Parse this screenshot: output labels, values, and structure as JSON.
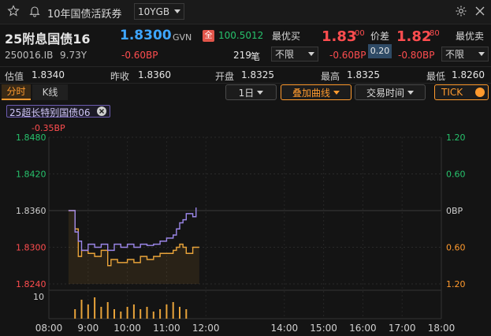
{
  "header": {
    "title": "10年国债活跃券",
    "dropdown_value": "10YGB"
  },
  "quote": {
    "name": "25附息国债16",
    "price": "1.8300",
    "price_unit": "GVN",
    "valuation_badge": "全",
    "valuation_price": "100.5012",
    "code": "250016.IB",
    "tenor": "9.73Y",
    "change": "-0.60BP",
    "volume": "219",
    "volume_unit": "笔",
    "best_buy_label": "最优买",
    "best_buy_main": "1.83",
    "best_buy_sub": "00",
    "best_buy_change": "-0.60BP",
    "best_buy_filter": "不限",
    "spread_label": "价差",
    "spread_value": "0.20",
    "best_sell_label": "最优卖",
    "best_sell_main": "1.82",
    "best_sell_sub": "80",
    "best_sell_change": "-0.80BP",
    "best_sell_filter": "不限"
  },
  "stats": {
    "valuation_label": "估值",
    "valuation_value": "1.8340",
    "prev_close_label": "昨收",
    "prev_close_value": "1.8360",
    "open_label": "开盘",
    "open_value": "1.8325",
    "high_label": "最高",
    "high_value": "1.8325",
    "low_label": "最低",
    "low_value": "1.8260"
  },
  "toolbar": {
    "tab_intraday": "分时",
    "tab_kline": "K线",
    "period": "1日",
    "overlay": "叠加曲线",
    "trade_time": "交易时间",
    "tick": "TICK"
  },
  "overlay_tag": "25超长特别国债06",
  "chart_data": {
    "type": "line",
    "overlay_change_label": "-0.35BP",
    "y_left_ticks": [
      "1.8480",
      "1.8420",
      "1.8360",
      "1.8300",
      "1.8240"
    ],
    "y_right_ticks": [
      "1.20",
      "0.60",
      "0BP",
      "0.60",
      "1.20"
    ],
    "ylim": [
      1.824,
      1.848
    ],
    "x_ticks": [
      "08:00",
      "9:00",
      "10:00",
      "11:00",
      "12:00",
      "14:00",
      "15:00",
      "16:00",
      "17:00",
      "18:00"
    ],
    "volume_tick": "10",
    "colors": {
      "main": "#e8a33a",
      "overlay": "#9b86e8",
      "left_axis": "#27c26c",
      "right_axis": "#ff9a2e"
    },
    "series": [
      {
        "name": "25附息国债16",
        "x": [
          "08:30",
          "08:40",
          "08:45",
          "08:50",
          "09:00",
          "09:10",
          "09:20",
          "09:30",
          "09:35",
          "09:45",
          "10:00",
          "10:10",
          "10:20",
          "10:30",
          "10:40",
          "10:50",
          "11:00",
          "11:10",
          "11:15",
          "11:20",
          "11:25",
          "11:30",
          "11:40",
          "11:50"
        ],
        "values": [
          1.836,
          1.833,
          1.8285,
          1.8295,
          1.829,
          1.8285,
          1.8295,
          1.827,
          1.828,
          1.8275,
          1.828,
          1.8275,
          1.8285,
          1.828,
          1.8285,
          1.829,
          1.829,
          1.8295,
          1.83,
          1.8305,
          1.83,
          1.829,
          1.83,
          1.83
        ]
      },
      {
        "name": "25超长特别国债06",
        "x": [
          "08:30",
          "08:40",
          "08:45",
          "08:50",
          "09:00",
          "09:10",
          "09:20",
          "09:30",
          "09:40",
          "09:50",
          "10:00",
          "10:10",
          "10:20",
          "10:30",
          "10:40",
          "10:50",
          "11:00",
          "11:10",
          "11:15",
          "11:20",
          "11:25",
          "11:30",
          "11:40",
          "11:45"
        ],
        "values": [
          1.836,
          1.8325,
          1.831,
          1.8295,
          1.8305,
          1.83,
          1.8305,
          1.8295,
          1.8305,
          1.83,
          1.8305,
          1.83,
          1.8305,
          1.8303,
          1.8305,
          1.831,
          1.8315,
          1.832,
          1.833,
          1.834,
          1.8345,
          1.8355,
          1.835,
          1.8365
        ]
      }
    ],
    "volume": {
      "x": [
        "08:40",
        "08:50",
        "09:00",
        "09:10",
        "09:20",
        "09:30",
        "09:40",
        "09:50",
        "10:00",
        "10:10",
        "10:20",
        "10:30",
        "10:40",
        "10:50",
        "11:00",
        "11:10",
        "11:20",
        "11:30"
      ],
      "values": [
        4,
        8,
        6,
        9,
        5,
        7,
        4,
        3,
        5,
        6,
        4,
        5,
        3,
        4,
        6,
        7,
        5,
        4
      ]
    }
  }
}
